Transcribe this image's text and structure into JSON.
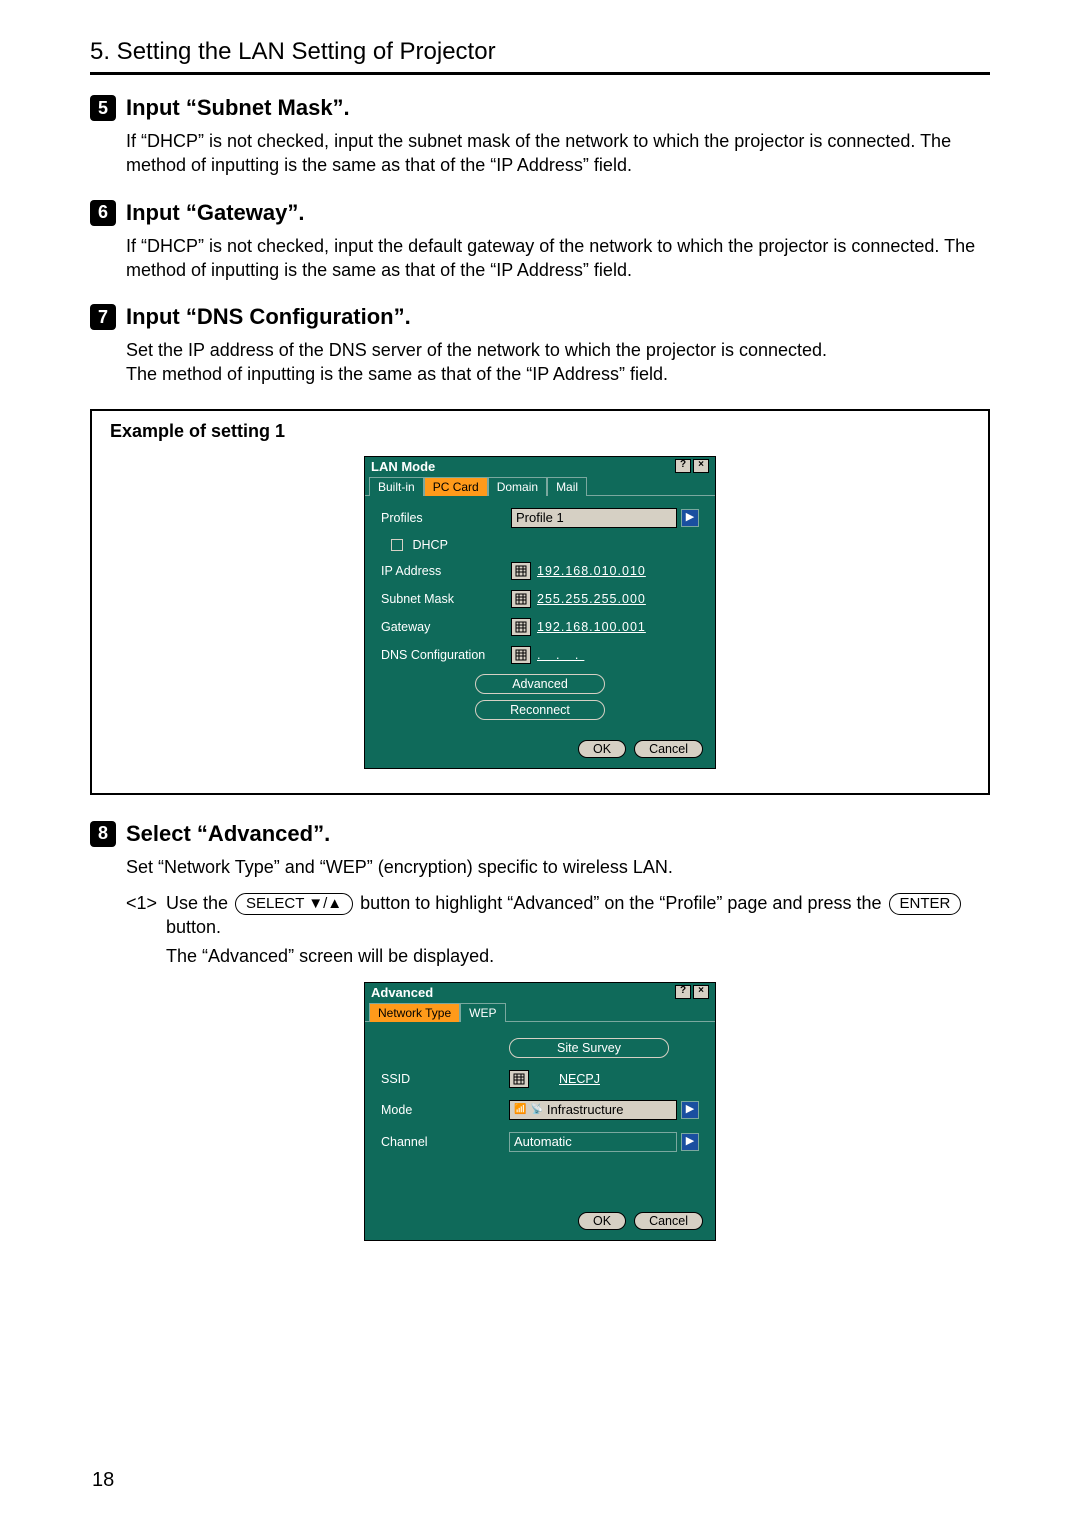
{
  "page_number": "18",
  "header": {
    "chapter_title": "5. Setting the LAN Setting of Projector"
  },
  "steps": [
    {
      "num": "5",
      "title": "Input “Subnet Mask”.",
      "body": "If “DHCP” is not checked, input the subnet mask of the network to which the projector is connected. The method of inputting is the same as that of the “IP Address” field."
    },
    {
      "num": "6",
      "title": "Input “Gateway”.",
      "body": "If “DHCP” is not checked, input the default gateway of the network to which the projector is connected. The method of inputting is the same as that of the “IP Address” field."
    },
    {
      "num": "7",
      "title": "Input “DNS Configuration”.",
      "body": "Set the IP address of the DNS server of the network to which the projector is connected.\nThe method of inputting is the same as that of the “IP Address” field."
    },
    {
      "num": "8",
      "title": "Select “Advanced”.",
      "body": "Set “Network Type” and “WEP” (encryption) specific to wireless LAN."
    }
  ],
  "example_label": "Example of setting 1",
  "lan_mode_dialog": {
    "title": "LAN Mode",
    "tabs": [
      "Built-in",
      "PC Card",
      "Domain",
      "Mail"
    ],
    "active_tab_index": 1,
    "profiles_label": "Profiles",
    "profiles_value": "Profile 1",
    "dhcp_label": "DHCP",
    "ip_label": "IP Address",
    "ip_value": "192.168.010.010",
    "subnet_label": "Subnet Mask",
    "subnet_value": "255.255.255.000",
    "gateway_label": "Gateway",
    "gateway_value": "192.168.100.001",
    "dns_label": "DNS Configuration",
    "dns_value": ".   .   .",
    "advanced_btn": "Advanced",
    "reconnect_btn": "Reconnect",
    "ok_btn": "OK",
    "cancel_btn": "Cancel"
  },
  "substep": {
    "num": "<1>",
    "pre": "Use the ",
    "key1": "SELECT ▼/▲",
    "mid": " button to highlight “Advanced” on the “Profile” page and press the ",
    "key2": "ENTER",
    "post": " button.",
    "after": "The “Advanced” screen will be displayed."
  },
  "advanced_dialog": {
    "title": "Advanced",
    "tabs": [
      "Network Type",
      "WEP"
    ],
    "active_tab_index": 0,
    "site_survey_btn": "Site Survey",
    "ssid_label": "SSID",
    "ssid_value": "NECPJ",
    "mode_label": "Mode",
    "mode_value": "Infrastructure",
    "channel_label": "Channel",
    "channel_value": "Automatic",
    "ok_btn": "OK",
    "cancel_btn": "Cancel"
  }
}
